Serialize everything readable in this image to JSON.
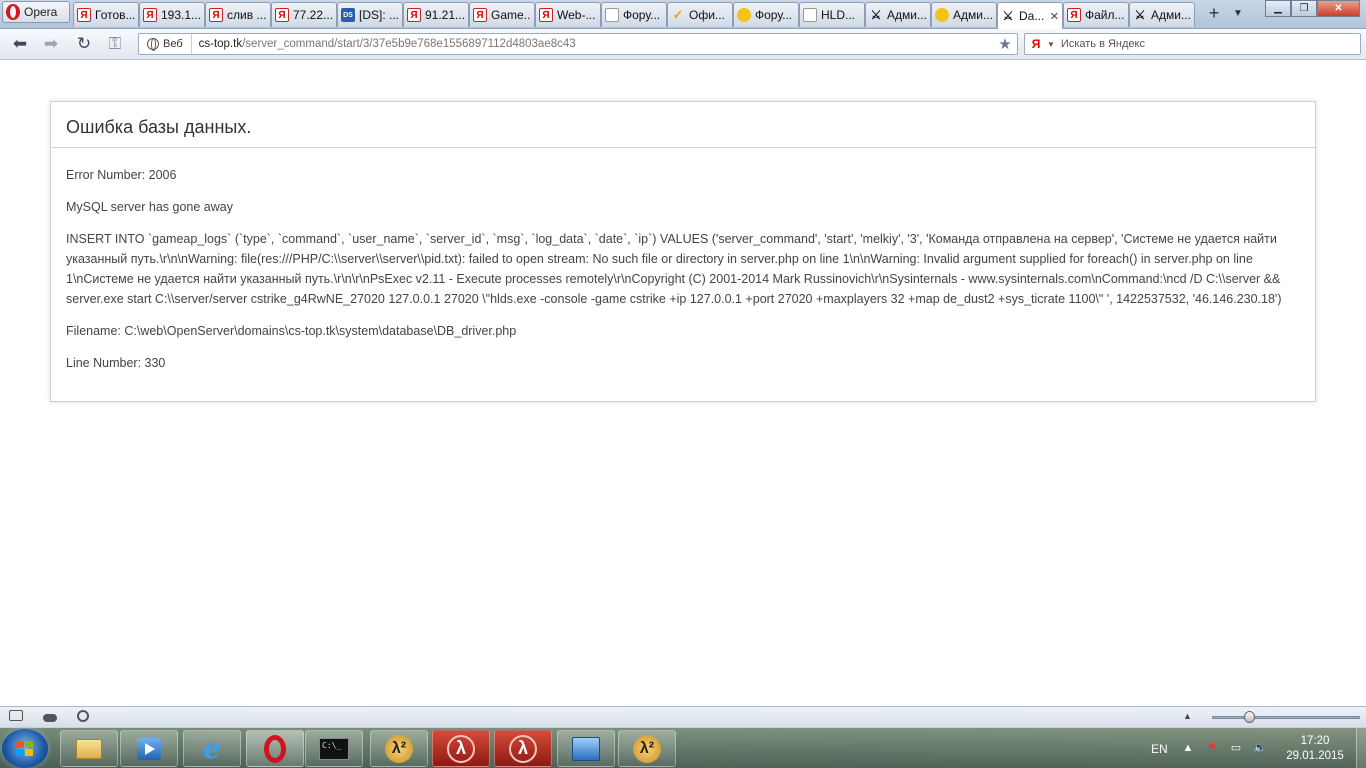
{
  "browser": {
    "menu_label": "Opera",
    "tabs": [
      {
        "label": "Готов...",
        "icon": "yandex-icon"
      },
      {
        "label": "193.1...",
        "icon": "yandex-icon"
      },
      {
        "label": "слив ...",
        "icon": "yandex-icon"
      },
      {
        "label": "77.22...",
        "icon": "yandex-icon"
      },
      {
        "label": "[DS]: ...",
        "icon": "ds-icon"
      },
      {
        "label": "91.21...",
        "icon": "yandex-icon"
      },
      {
        "label": "Game...",
        "icon": "yandex-icon"
      },
      {
        "label": "Web-...",
        "icon": "yandex-icon"
      },
      {
        "label": "Фору...",
        "icon": "document-icon"
      },
      {
        "label": "Офи...",
        "icon": "checkmark-icon"
      },
      {
        "label": "Фору...",
        "icon": "crown-icon"
      },
      {
        "label": "HLD...",
        "icon": "document-icon"
      },
      {
        "label": "Адми...",
        "icon": "counter-strike-icon"
      },
      {
        "label": "Адми...",
        "icon": "crown-icon"
      },
      {
        "label": "Da...",
        "icon": "counter-strike-icon",
        "active": true
      },
      {
        "label": "Файл...",
        "icon": "yandex-icon"
      },
      {
        "label": "Адми...",
        "icon": "counter-strike-icon"
      }
    ],
    "address": {
      "badge": "Веб",
      "host": "cs-top.tk",
      "path": "/server_command/start/3/37e5b9e768e1556897112d4803ae8c43"
    },
    "search_placeholder": "Искать в Яндекс"
  },
  "page": {
    "title": "Ошибка базы данных.",
    "error_number": "Error Number: 2006",
    "message": "MySQL server has gone away",
    "query": "INSERT INTO `gameap_logs` (`type`, `command`, `user_name`, `server_id`, `msg`, `log_data`, `date`, `ip`) VALUES ('server_command', 'start', 'melkiy', '3', 'Команда отправлена на сервер', 'Системе не удается найти указанный путь.\\r\\n\\nWarning: file(res:///PHP/C:\\\\server\\\\server\\\\pid.txt): failed to open stream: No such file or directory in server.php on line 1\\n\\nWarning: Invalid argument supplied for foreach() in server.php on line 1\\nСистеме не удается найти указанный путь.\\r\\n\\r\\nPsExec v2.11 - Execute processes remotely\\r\\nCopyright (C) 2001-2014 Mark Russinovich\\r\\nSysinternals - www.sysinternals.com\\nCommand:\\ncd /D C:\\\\server && server.exe start C:\\\\server/server cstrike_g4RwNE_27020 127.0.0.1 27020 \\\"hlds.exe -console -game cstrike +ip 127.0.0.1 +port 27020 +maxplayers 32 +map de_dust2 +sys_ticrate 1100\\\" ', 1422537532, '46.146.230.18')",
    "filename": "Filename: C:\\web\\OpenServer\\domains\\cs-top.tk\\system\\database\\DB_driver.php",
    "line_number": "Line Number: 330"
  },
  "statusbar": {
    "zoom_level": 0.25
  },
  "taskbar": {
    "items": [
      "folder-icon",
      "media-player-icon",
      "internet-explorer-icon",
      "opera-icon",
      "command-prompt-icon",
      "half-life-2-icon",
      "half-life-icon",
      "half-life-icon",
      "network-icon",
      "half-life-2-icon"
    ],
    "language": "EN",
    "time": "17:20",
    "date": "29.01.2015"
  },
  "colors": {
    "accent": "#2b6dbf",
    "error_border": "#d0d0d0"
  }
}
